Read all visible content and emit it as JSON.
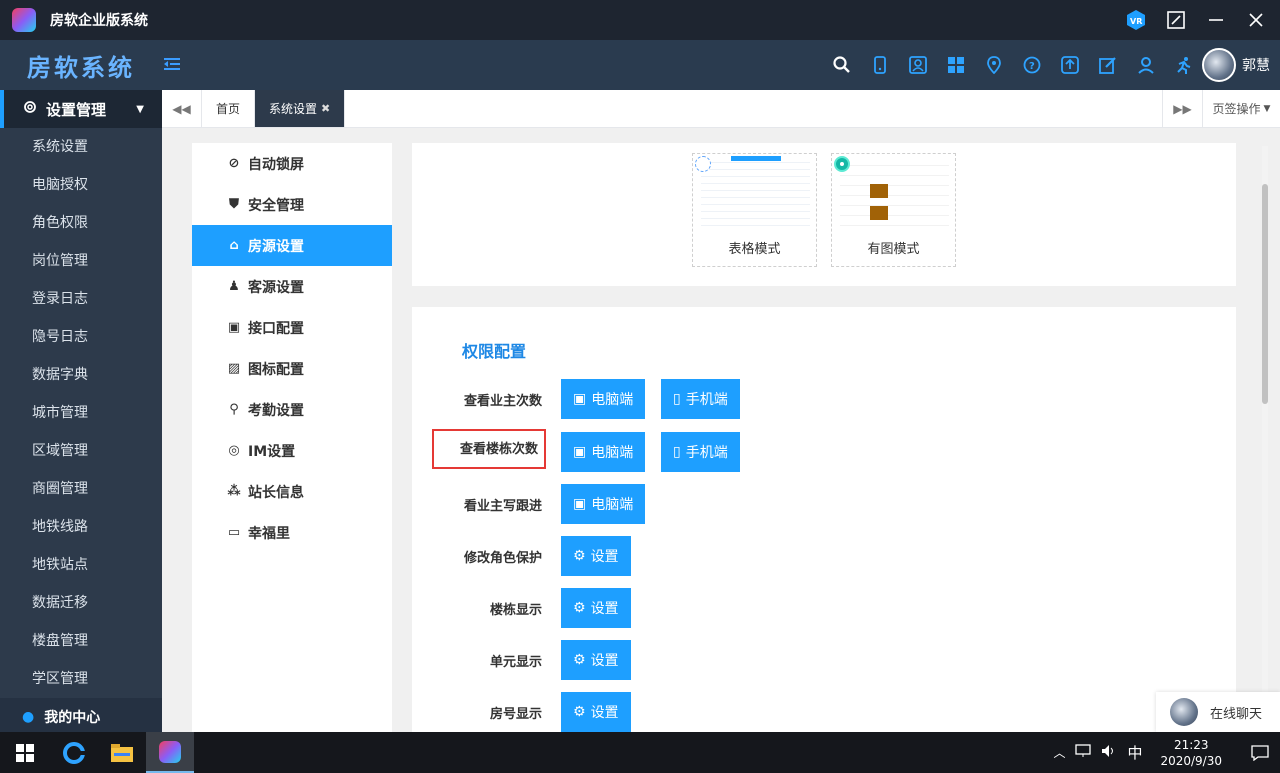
{
  "window": {
    "title": "房软企业版系统",
    "controls": [
      "vr-icon",
      "screenshot-icon",
      "minimize-icon",
      "close-icon"
    ]
  },
  "topbar": {
    "brand": "房软系统",
    "tool_icons": [
      "search-icon",
      "phone-icon",
      "contacts-icon",
      "grid-icon",
      "location-icon",
      "help-icon",
      "upload-icon",
      "edit-icon",
      "user-icon",
      "run-icon"
    ],
    "user_name": "郭慧"
  },
  "sidebar": {
    "header": "设置管理",
    "items": [
      {
        "label": "系统设置"
      },
      {
        "label": "电脑授权"
      },
      {
        "label": "角色权限"
      },
      {
        "label": "岗位管理"
      },
      {
        "label": "登录日志"
      },
      {
        "label": "隐号日志"
      },
      {
        "label": "数据字典"
      },
      {
        "label": "城市管理"
      },
      {
        "label": "区域管理"
      },
      {
        "label": "商圈管理"
      },
      {
        "label": "地铁线路"
      },
      {
        "label": "地铁站点"
      },
      {
        "label": "数据迁移"
      },
      {
        "label": "楼盘管理"
      },
      {
        "label": "学区管理"
      }
    ],
    "footer": "我的中心"
  },
  "tabs": {
    "home": "首页",
    "active": "系统设置",
    "ops": "页签操作"
  },
  "settings_nav": [
    {
      "label": "自动锁屏",
      "icon": "ban-icon",
      "active": false
    },
    {
      "label": "安全管理",
      "icon": "shield-icon",
      "active": false
    },
    {
      "label": "房源设置",
      "icon": "home-icon",
      "active": true
    },
    {
      "label": "客源设置",
      "icon": "person-icon",
      "active": false
    },
    {
      "label": "接口配置",
      "icon": "api-icon",
      "active": false
    },
    {
      "label": "图标配置",
      "icon": "image-icon",
      "active": false
    },
    {
      "label": "考勤设置",
      "icon": "location-icon",
      "active": false
    },
    {
      "label": "IM设置",
      "icon": "chat-icon",
      "active": false
    },
    {
      "label": "站长信息",
      "icon": "sitemap-icon",
      "active": false
    },
    {
      "label": "幸福里",
      "icon": "monitor-icon",
      "active": false
    }
  ],
  "modes": {
    "table": "表格模式",
    "image": "有图模式",
    "selected": "image"
  },
  "permissions": {
    "title": "权限配置",
    "rows": [
      {
        "label": "查看业主次数",
        "buttons": [
          "电脑端",
          "手机端"
        ],
        "highlighted": false
      },
      {
        "label": "查看楼栋次数",
        "buttons": [
          "电脑端",
          "手机端"
        ],
        "highlighted": true
      },
      {
        "label": "看业主写跟进",
        "buttons": [
          "电脑端"
        ],
        "highlighted": false
      },
      {
        "label": "修改角色保护",
        "buttons": [
          "设置"
        ],
        "highlighted": false
      },
      {
        "label": "楼栋显示",
        "buttons": [
          "设置"
        ],
        "highlighted": false
      },
      {
        "label": "单元显示",
        "buttons": [
          "设置"
        ],
        "highlighted": false
      },
      {
        "label": "房号显示",
        "buttons": [
          "设置"
        ],
        "highlighted": false
      }
    ]
  },
  "chat": {
    "label": "在线聊天"
  },
  "taskbar": {
    "ime": "中",
    "time": "21:23",
    "date": "2020/9/30"
  },
  "colors": {
    "accent": "#1e9fff",
    "sidebar_bg": "#2d3a4b",
    "highlight_border": "#e53935"
  }
}
